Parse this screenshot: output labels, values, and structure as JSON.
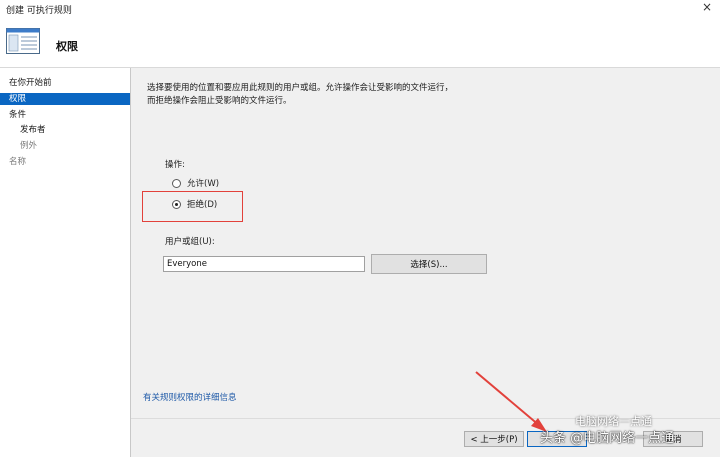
{
  "window": {
    "title": "创建 可执行规则",
    "close_glyph": "×"
  },
  "header": {
    "title": "权限",
    "icon": "window-list-icon"
  },
  "sidebar": {
    "items": [
      {
        "label": "在你开始前"
      },
      {
        "label": "权限"
      },
      {
        "label": "条件"
      },
      {
        "label": "发布者"
      },
      {
        "label": "例外"
      },
      {
        "label": "名称"
      }
    ]
  },
  "main": {
    "description_line1": "选择要使用的位置和要应用此规则的用户或组。允许操作会让受影响的文件运行，",
    "description_line2": "而拒绝操作会阻止受影响的文件运行。",
    "action_label": "操作:",
    "allow_label": "允许(W)",
    "deny_label": "拒绝(D)",
    "selected_action": "deny",
    "user_group_label": "用户或组(U):",
    "user_group_value": "Everyone",
    "select_button": "选择(S)...",
    "help_link": "有关规则权限的详细信息"
  },
  "footer": {
    "back_button": "< 上一步(P)",
    "cancel_button": "取消"
  },
  "watermark": {
    "top_text": "电脑网络一点通",
    "main_text": "头条 @电脑网络一点通"
  },
  "colors": {
    "accent": "#0a66c2",
    "highlight_border": "#e2413b",
    "link": "#1f5aa8"
  }
}
